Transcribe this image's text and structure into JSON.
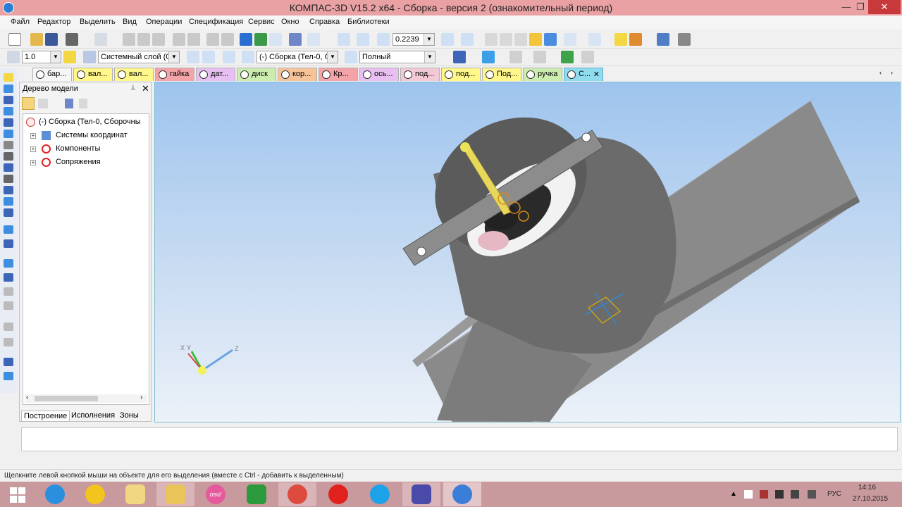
{
  "window": {
    "title": "КОМПАС-3D V15.2  x64 - Сборка - версия 2 (ознакомительный период)",
    "min_glyph": "—",
    "max_glyph": "❐",
    "close_glyph": "✕"
  },
  "menu": [
    "Файл",
    "Редактор",
    "Выделить",
    "Вид",
    "Операции",
    "Спецификация",
    "Сервис",
    "Окно",
    "Справка",
    "Библиотеки"
  ],
  "toolbar": {
    "zoom_value": "0.2239",
    "step_value": "1.0",
    "layer_value": "Системный слой (0)",
    "part_value": "(-) Сборка (Тел-0, С",
    "display_mode_value": "Полный"
  },
  "tabs": [
    {
      "label": "бар...",
      "color": "#f6f6f6"
    },
    {
      "label": "вал...",
      "color": "#fff78a"
    },
    {
      "label": "вал...",
      "color": "#fff78a"
    },
    {
      "label": "гайка",
      "color": "#f4a3a8"
    },
    {
      "label": "дат...",
      "color": "#e7bff0"
    },
    {
      "label": "диск",
      "color": "#ccecb0"
    },
    {
      "label": "кор...",
      "color": "#f7c49a"
    },
    {
      "label": "Кр...",
      "color": "#f4a3a8"
    },
    {
      "label": "ось...",
      "color": "#e7bff0"
    },
    {
      "label": "под...",
      "color": "#f2c9d4"
    },
    {
      "label": "под...",
      "color": "#fff78a"
    },
    {
      "label": "Под...",
      "color": "#fff78a"
    },
    {
      "label": "ручка",
      "color": "#ccecb0"
    },
    {
      "label": "С...",
      "color": "#8fdcef"
    }
  ],
  "tab_close_glyph": "✕",
  "tree_panel": {
    "title": "Дерево модели",
    "pin_glyph": "📌",
    "close_glyph": "✕",
    "root": "(-) Сборка (Тел-0, Сборочны",
    "children": [
      "Системы координат",
      "Компоненты",
      "Сопряжения"
    ],
    "bottom_tabs": [
      "Построение",
      "Исполнения",
      "Зоны"
    ],
    "expander_glyph": "+",
    "scroll_left_glyph": "‹",
    "scroll_right_glyph": "›"
  },
  "axes": {
    "x": "X",
    "y": "Y",
    "z": "Z"
  },
  "status": "Щелкните левой кнопкой мыши на объекте для его выделения (вместе с Ctrl - добавить к выделенным)",
  "taskbar": {
    "apps": [
      "start",
      "internet-explorer",
      "archicad",
      "file-manager",
      "explorer",
      "osu",
      "store",
      "chrome",
      "opera",
      "skype",
      "settings",
      "kompas"
    ],
    "osu_label": "osu!",
    "lang": "РУС",
    "time": "14:16",
    "date": "27.10.2015"
  }
}
